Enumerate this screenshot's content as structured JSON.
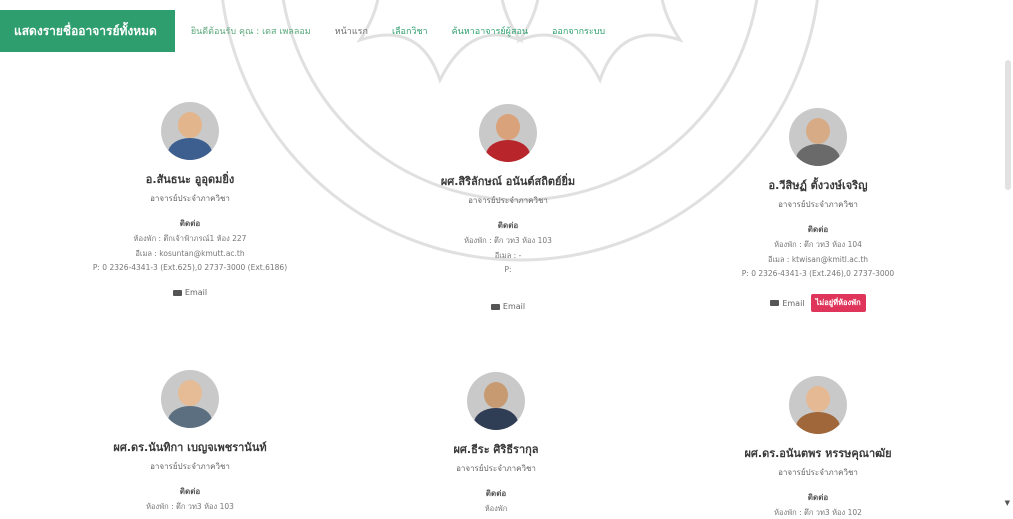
{
  "header": {
    "brand": "แสดงรายชื่ออาจารย์ทั้งหมด",
    "welcome": "ยินดีต้อนรับ คุณ : เดส เพลลอม",
    "nav": [
      "หน้าแรก",
      "เลือกวิชา",
      "ค้นหาอาจารย์ผู้สอน",
      "ออกจากระบบ"
    ]
  },
  "labels": {
    "contact": "ติดต่อ",
    "email_btn": "Email"
  },
  "teachers": [
    {
      "name": "อ.สันธนะ อูอุดมยิ่ง",
      "position": "อาจารย์ประจำภาควิชา",
      "room": "ห้องพัก : ตึกเจ้าฟ้าภรณ์1 ห้อง 227",
      "email": "อีเมล : kosuntan@kmutt.ac.th",
      "phone": "P: 0 2326-4341-3 (Ext.625),0 2737-3000 (Ext.6186)",
      "badge": "",
      "avatar_color": "#3d5f8f"
    },
    {
      "name": "ผศ.สิริลักษณ์ อนันต์สถิตย์ยิ่ม",
      "position": "อาจารย์ประจำภาควิชา",
      "room": "ห้องพัก : ตึก วท3 ห้อง 103",
      "email": "อีเมล : -",
      "phone": "P:",
      "badge": "",
      "avatar_color": "#b8262c"
    },
    {
      "name": "อ.วีสิษฏ์ ตั้งวงษ์เจริญ",
      "position": "อาจารย์ประจำภาควิชา",
      "room": "ห้องพัก : ตึก วท3 ห้อง 104",
      "email": "อีเมล : ktwisan@kmitl.ac.th",
      "phone": "P: 0 2326-4341-3 (Ext.246),0 2737-3000",
      "badge": "ไม่อยู่ที่ห้องพัก",
      "avatar_color": "#6a6a6a"
    },
    {
      "name": "ผศ.ดร.นันทิกา เบญจเพชรานันท์",
      "position": "อาจารย์ประจำภาควิชา",
      "room": "ห้องพัก : ตึก วท3 ห้อง 103",
      "email": "",
      "phone": "",
      "badge": "",
      "avatar_color": "#5c6f80"
    },
    {
      "name": "ผศ.ธีระ ศิริธีรากุล",
      "position": "อาจารย์ประจำภาควิชา",
      "room": "ห้องพัก",
      "email": "",
      "phone": "",
      "badge": "",
      "avatar_color": "#2f3d55"
    },
    {
      "name": "ผศ.ดร.อนันตพร หรรษคุณาฒัย",
      "position": "อาจารย์ประจำภาควิชา",
      "room": "ห้องพัก : ตึก วท3 ห้อง 102",
      "email": "",
      "phone": "",
      "badge": "",
      "avatar_color": "#a0673a"
    }
  ]
}
